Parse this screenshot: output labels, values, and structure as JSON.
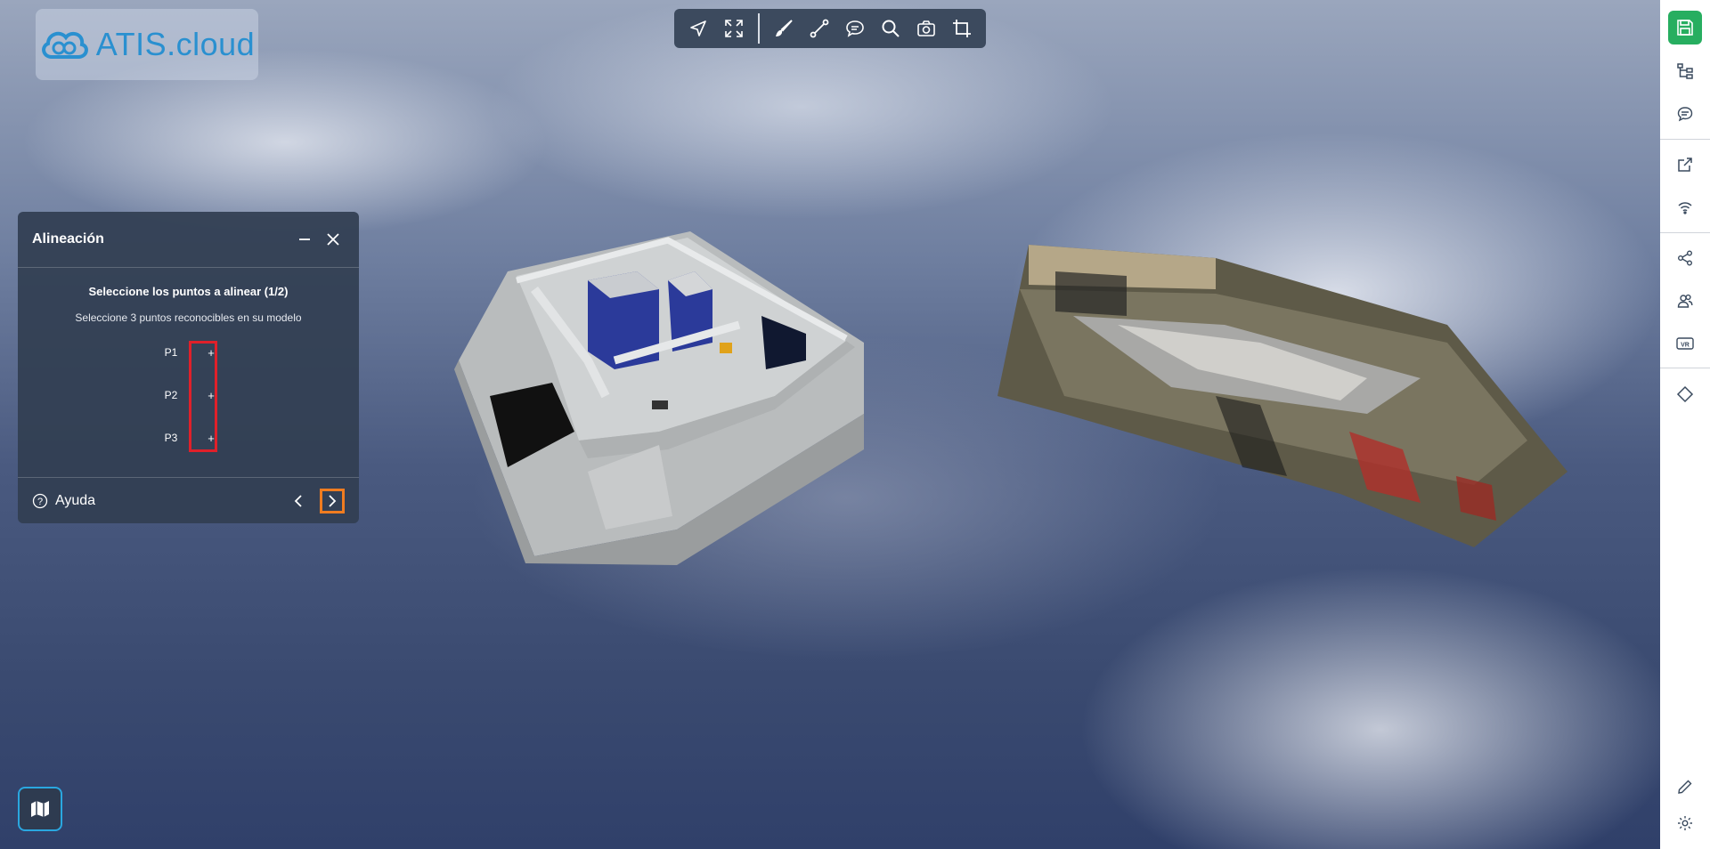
{
  "app": {
    "logo_text": "ATIS.cloud"
  },
  "toolbar": {
    "tools": [
      {
        "name": "navigate-icon"
      },
      {
        "name": "fullscreen-icon"
      },
      {
        "name": "brush-icon"
      },
      {
        "name": "measure-icon"
      },
      {
        "name": "comment-icon"
      },
      {
        "name": "search-icon"
      },
      {
        "name": "camera-icon"
      },
      {
        "name": "crop-icon"
      }
    ]
  },
  "panel": {
    "title": "Alineación",
    "step_title": "Seleccione los puntos a alinear (1/2)",
    "step_subtitle": "Seleccione 3 puntos reconocibles en su modelo",
    "points": [
      {
        "label": "P1",
        "action": "+"
      },
      {
        "label": "P2",
        "action": "+"
      },
      {
        "label": "P3",
        "action": "+"
      }
    ],
    "help_label": "Ayuda"
  },
  "sidebar": {
    "items": [
      "save-icon",
      "tree-icon",
      "chat-icon",
      "external-link-icon",
      "wifi-icon",
      "share-icon",
      "users-icon",
      "vr-icon",
      "diamond-icon",
      "pencil-icon",
      "settings-icon"
    ]
  },
  "colors": {
    "save": "#27ae60",
    "highlight_red": "#e0202a",
    "highlight_orange": "#f07c20",
    "toolbar": "#3c4a5e",
    "map_border": "#2aa7e0"
  }
}
